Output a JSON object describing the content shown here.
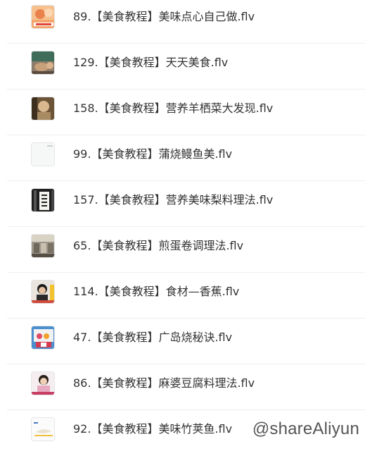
{
  "files": [
    {
      "name": "89.【美食教程】美味点心自己做.flv",
      "thumbnail": "dessert-thumbnail"
    },
    {
      "name": "129.【美食教程】天天美食.flv",
      "thumbnail": "cooking-thumbnail"
    },
    {
      "name": "158.【美食教程】营养羊栖菜大发现.flv",
      "thumbnail": "person-thumbnail"
    },
    {
      "name": "99.【美食教程】蒲烧鳗鱼美.flv",
      "thumbnail": "blank-thumbnail"
    },
    {
      "name": "157.【美食教程】营养美味梨料理法.flv",
      "thumbnail": "sign-thumbnail"
    },
    {
      "name": "65.【美食教程】煎蛋卷调理法.flv",
      "thumbnail": "shop-thumbnail"
    },
    {
      "name": "114.【美食教程】食材—香蕉.flv",
      "thumbnail": "presenter-thumbnail"
    },
    {
      "name": "47.【美食教程】广岛烧秘诀.flv",
      "thumbnail": "stage-thumbnail"
    },
    {
      "name": "86.【美食教程】麻婆豆腐料理法.flv",
      "thumbnail": "host-thumbnail"
    },
    {
      "name": "92.【美食教程】美味竹荚鱼.flv",
      "thumbnail": "fish-thumbnail"
    }
  ],
  "watermark": "@shareAliyun"
}
